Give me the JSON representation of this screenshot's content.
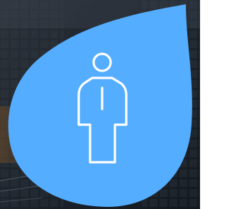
{
  "badge": {
    "icon": "person-icon",
    "shape": "drop",
    "accent_color": "#55adff",
    "icon_color": "#ffffff"
  },
  "background": {
    "description_icon": "office-building-photo",
    "base_color": "#1b2129"
  }
}
